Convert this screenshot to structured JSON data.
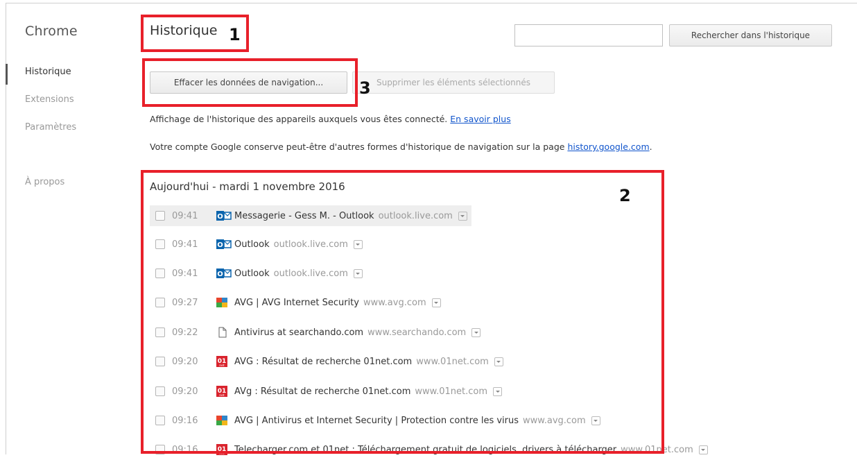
{
  "sidebar": {
    "brand": "Chrome",
    "items": [
      {
        "label": "Historique",
        "active": true
      },
      {
        "label": "Extensions",
        "active": false
      },
      {
        "label": "Paramètres",
        "active": false
      },
      {
        "label": "À propos",
        "active": false
      }
    ]
  },
  "header": {
    "title": "Historique",
    "search_value": "",
    "search_button": "Rechercher dans l'historique"
  },
  "toolbar": {
    "clear_button": "Effacer les données de navigation...",
    "remove_button": "Supprimer les éléments sélectionnés"
  },
  "info": {
    "devices_text": "Affichage de l'historique des appareils auxquels vous êtes connecté.",
    "devices_link": "En savoir plus",
    "google_text": "Votre compte Google conserve peut-être d'autres formes d'historique de navigation sur la page",
    "google_link": "history.google.com",
    "google_suffix": "."
  },
  "history": {
    "date_header": "Aujourd'hui - mardi 1 novembre 2016",
    "entries": [
      {
        "time": "09:41",
        "icon": "outlook-icon",
        "title": "Messagerie - Gess M. - Outlook",
        "domain": "outlook.live.com"
      },
      {
        "time": "09:41",
        "icon": "outlook-icon",
        "title": "Outlook",
        "domain": "outlook.live.com"
      },
      {
        "time": "09:41",
        "icon": "outlook-icon",
        "title": "Outlook",
        "domain": "outlook.live.com"
      },
      {
        "time": "09:27",
        "icon": "avg-icon",
        "title": "AVG | AVG Internet Security",
        "domain": "www.avg.com"
      },
      {
        "time": "09:22",
        "icon": "page-icon",
        "title": "Antivirus at searchando.com",
        "domain": "www.searchando.com"
      },
      {
        "time": "09:20",
        "icon": "01net-icon",
        "title": "AVG : Résultat de recherche 01net.com",
        "domain": "www.01net.com"
      },
      {
        "time": "09:20",
        "icon": "01net-icon",
        "title": "AVg : Résultat de recherche 01net.com",
        "domain": "www.01net.com"
      },
      {
        "time": "09:16",
        "icon": "avg-icon",
        "title": "AVG | Antivirus et Internet Security | Protection contre les virus",
        "domain": "www.avg.com"
      },
      {
        "time": "09:16",
        "icon": "01net-icon",
        "title": "Telecharger.com et 01net : Téléchargement gratuit de logiciels, drivers à télécharger",
        "domain": "www.01net.com"
      }
    ]
  },
  "annotations": [
    "1",
    "2",
    "3"
  ],
  "colors": {
    "annotation": "#e8202a",
    "link": "#1155cc",
    "muted": "#999999"
  }
}
